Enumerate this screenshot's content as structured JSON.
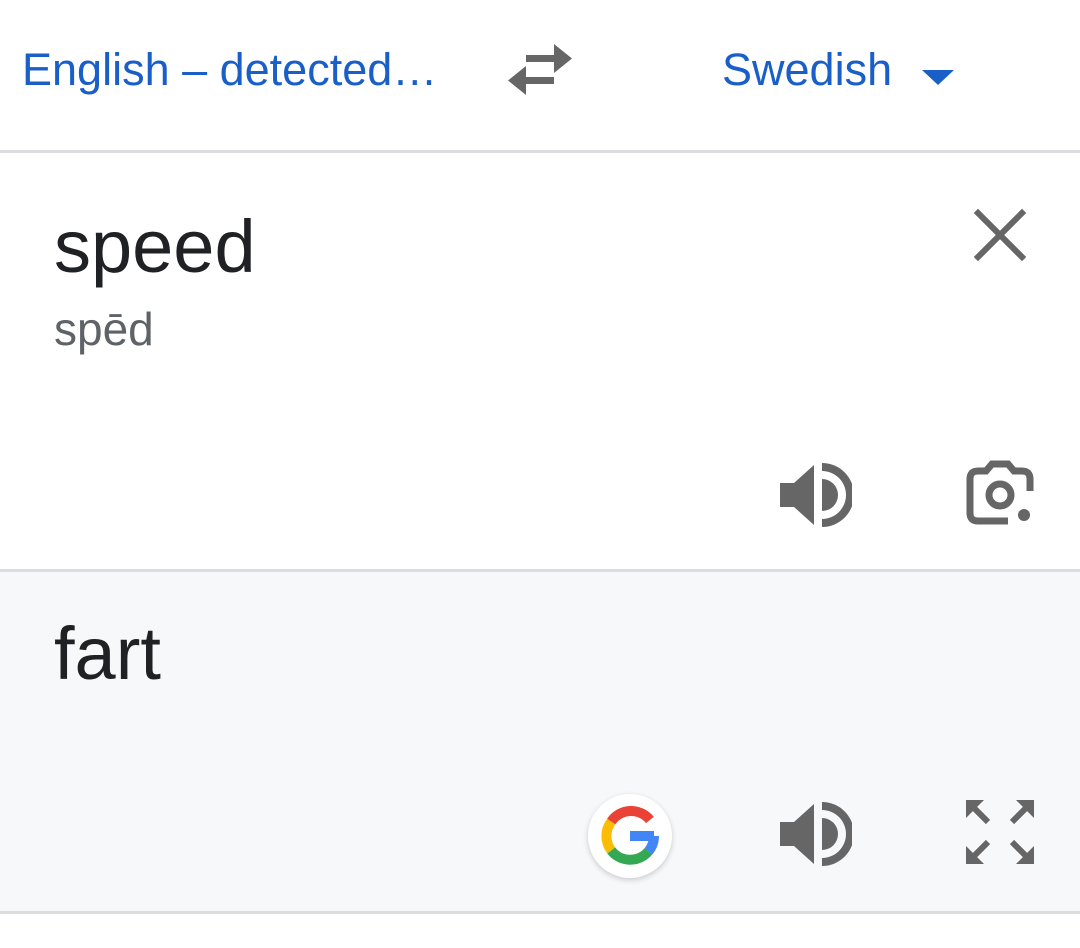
{
  "language_bar": {
    "source_language": "English – detected…",
    "target_language": "Swedish"
  },
  "source": {
    "text": "speed",
    "transliteration": "spēd"
  },
  "result": {
    "text": "fart"
  },
  "icons": {
    "swap": "swap-languages-icon",
    "dropdown": "chevron-down-icon",
    "clear": "close-icon",
    "speaker": "speaker-icon",
    "camera": "lens-camera-icon",
    "google": "google-logo-icon",
    "fullscreen": "fullscreen-icon"
  },
  "colors": {
    "accent": "#1a5fc8",
    "icon_gray": "#5f6368",
    "text": "#202124",
    "result_bg": "#f7f8fa"
  }
}
